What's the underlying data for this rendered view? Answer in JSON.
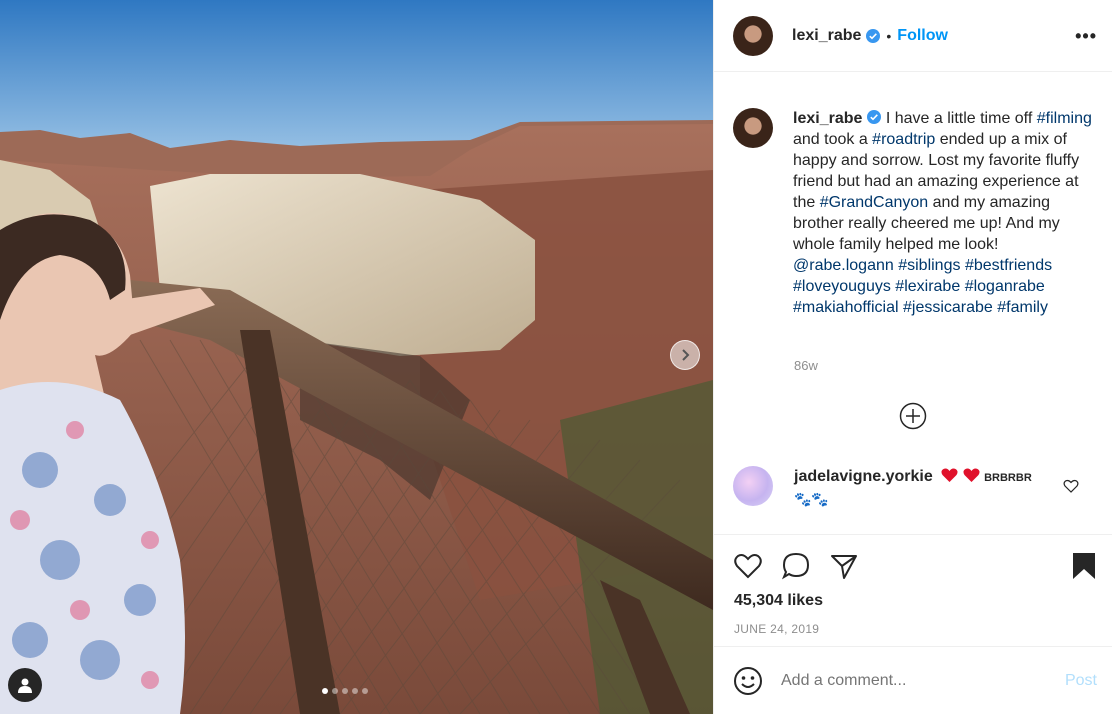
{
  "post": {
    "username": "lexi_rabe",
    "follow_label": "Follow",
    "separator": "•",
    "more_label": "•••",
    "carousel": {
      "slides": 5,
      "active": 1
    }
  },
  "caption": {
    "username": "lexi_rabe",
    "parts": [
      " I have a little time off ",
      "#filming",
      " and took a ",
      "#roadtrip",
      " ended up a mix of happy and sorrow. Lost my favorite fluffy friend but had an amazing experience at the ",
      "#GrandCanyon",
      " and my amazing brother really cheered me up! And my whole family helped me look! ",
      "@rabe.logann",
      " ",
      "#siblings",
      " ",
      "#bestfriends",
      " ",
      "#loveyouguys",
      " ",
      "#lexirabe",
      " ",
      "#loganrabe",
      " ",
      "#makiahofficial",
      " ",
      "#jessicarabe",
      " ",
      "#family"
    ],
    "age": "86w"
  },
  "comments": [
    {
      "username": "jadelavigne.yorkie",
      "text_suffix": "BRBRBR",
      "emoji_line": "🐾🐾"
    }
  ],
  "actions": {
    "likes": "45,304 likes",
    "date": "JUNE 24, 2019"
  },
  "add_comment": {
    "placeholder": "Add a comment...",
    "post_label": "Post"
  },
  "colors": {
    "accent": "#0095f6",
    "hashtag": "#00376b",
    "muted": "#8e8e8e",
    "post_disabled": "#b2dffc"
  }
}
